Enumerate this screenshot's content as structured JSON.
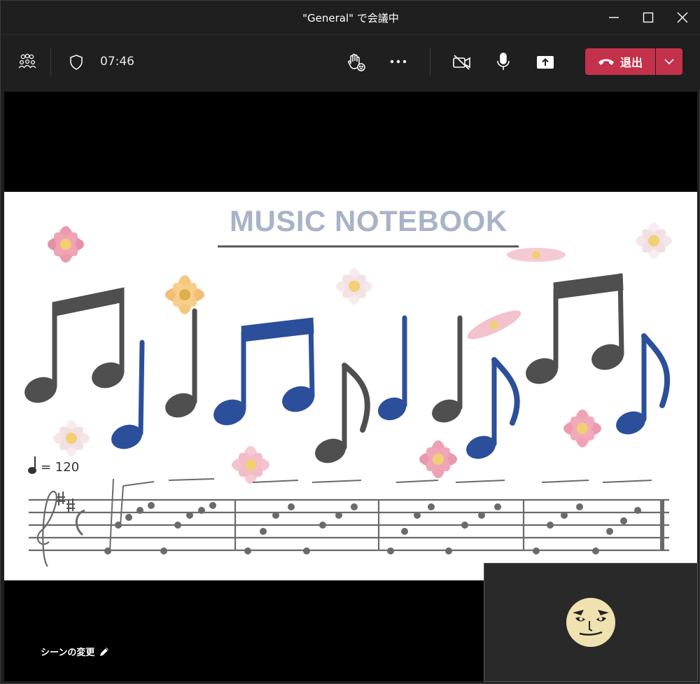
{
  "window": {
    "title": "\"General\" で会議中"
  },
  "window_controls": {
    "minimize_icon": "minimize-icon",
    "maximize_icon": "maximize-icon",
    "close_icon": "close-icon"
  },
  "toolbar": {
    "timer": "07:46",
    "leave_label": "退出",
    "icons": [
      "people-icon",
      "shield-icon",
      "raise-hand-icon",
      "more-icon",
      "camera-off-icon",
      "microphone-icon",
      "share-screen-icon",
      "phone-hangup-icon",
      "chevron-down-icon"
    ],
    "leave_color": "#c4314b"
  },
  "shared_content": {
    "title": "MUSIC NOTEBOOK",
    "tempo": "= 120",
    "note_colors": {
      "dark": "#4f4f4f",
      "blue": "#2b4f9a"
    }
  },
  "scene": {
    "change_label": "シーンの変更"
  }
}
